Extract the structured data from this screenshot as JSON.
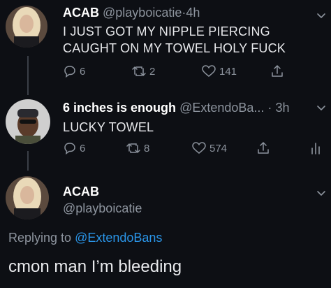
{
  "tweet1": {
    "name": "ACAB",
    "handle": "@playboicatie",
    "dot": "·",
    "time": "4h",
    "text_line1": "I JUST GOT MY NIPPLE PIERCING",
    "text_line2": "CAUGHT ON MY TOWEL HOLY FUCK",
    "replies": "6",
    "retweets": "2",
    "likes": "141"
  },
  "tweet2": {
    "name": "6 inches is enough",
    "handle": "@ExtendoBa...",
    "dot": "·",
    "time": "3h",
    "text": "LUCKY TOWEL",
    "replies": "6",
    "retweets": "8",
    "likes": "574"
  },
  "tweet3": {
    "name": "ACAB",
    "handle": "@playboicatie",
    "replying_prefix": "Replying to",
    "replying_mention": "@ExtendoBans",
    "text": "cmon man I’m bleeding"
  },
  "colors": {
    "background": "#0d0f14",
    "text": "#e8e9ec",
    "muted": "#8d949e",
    "link": "#2a95e8"
  }
}
